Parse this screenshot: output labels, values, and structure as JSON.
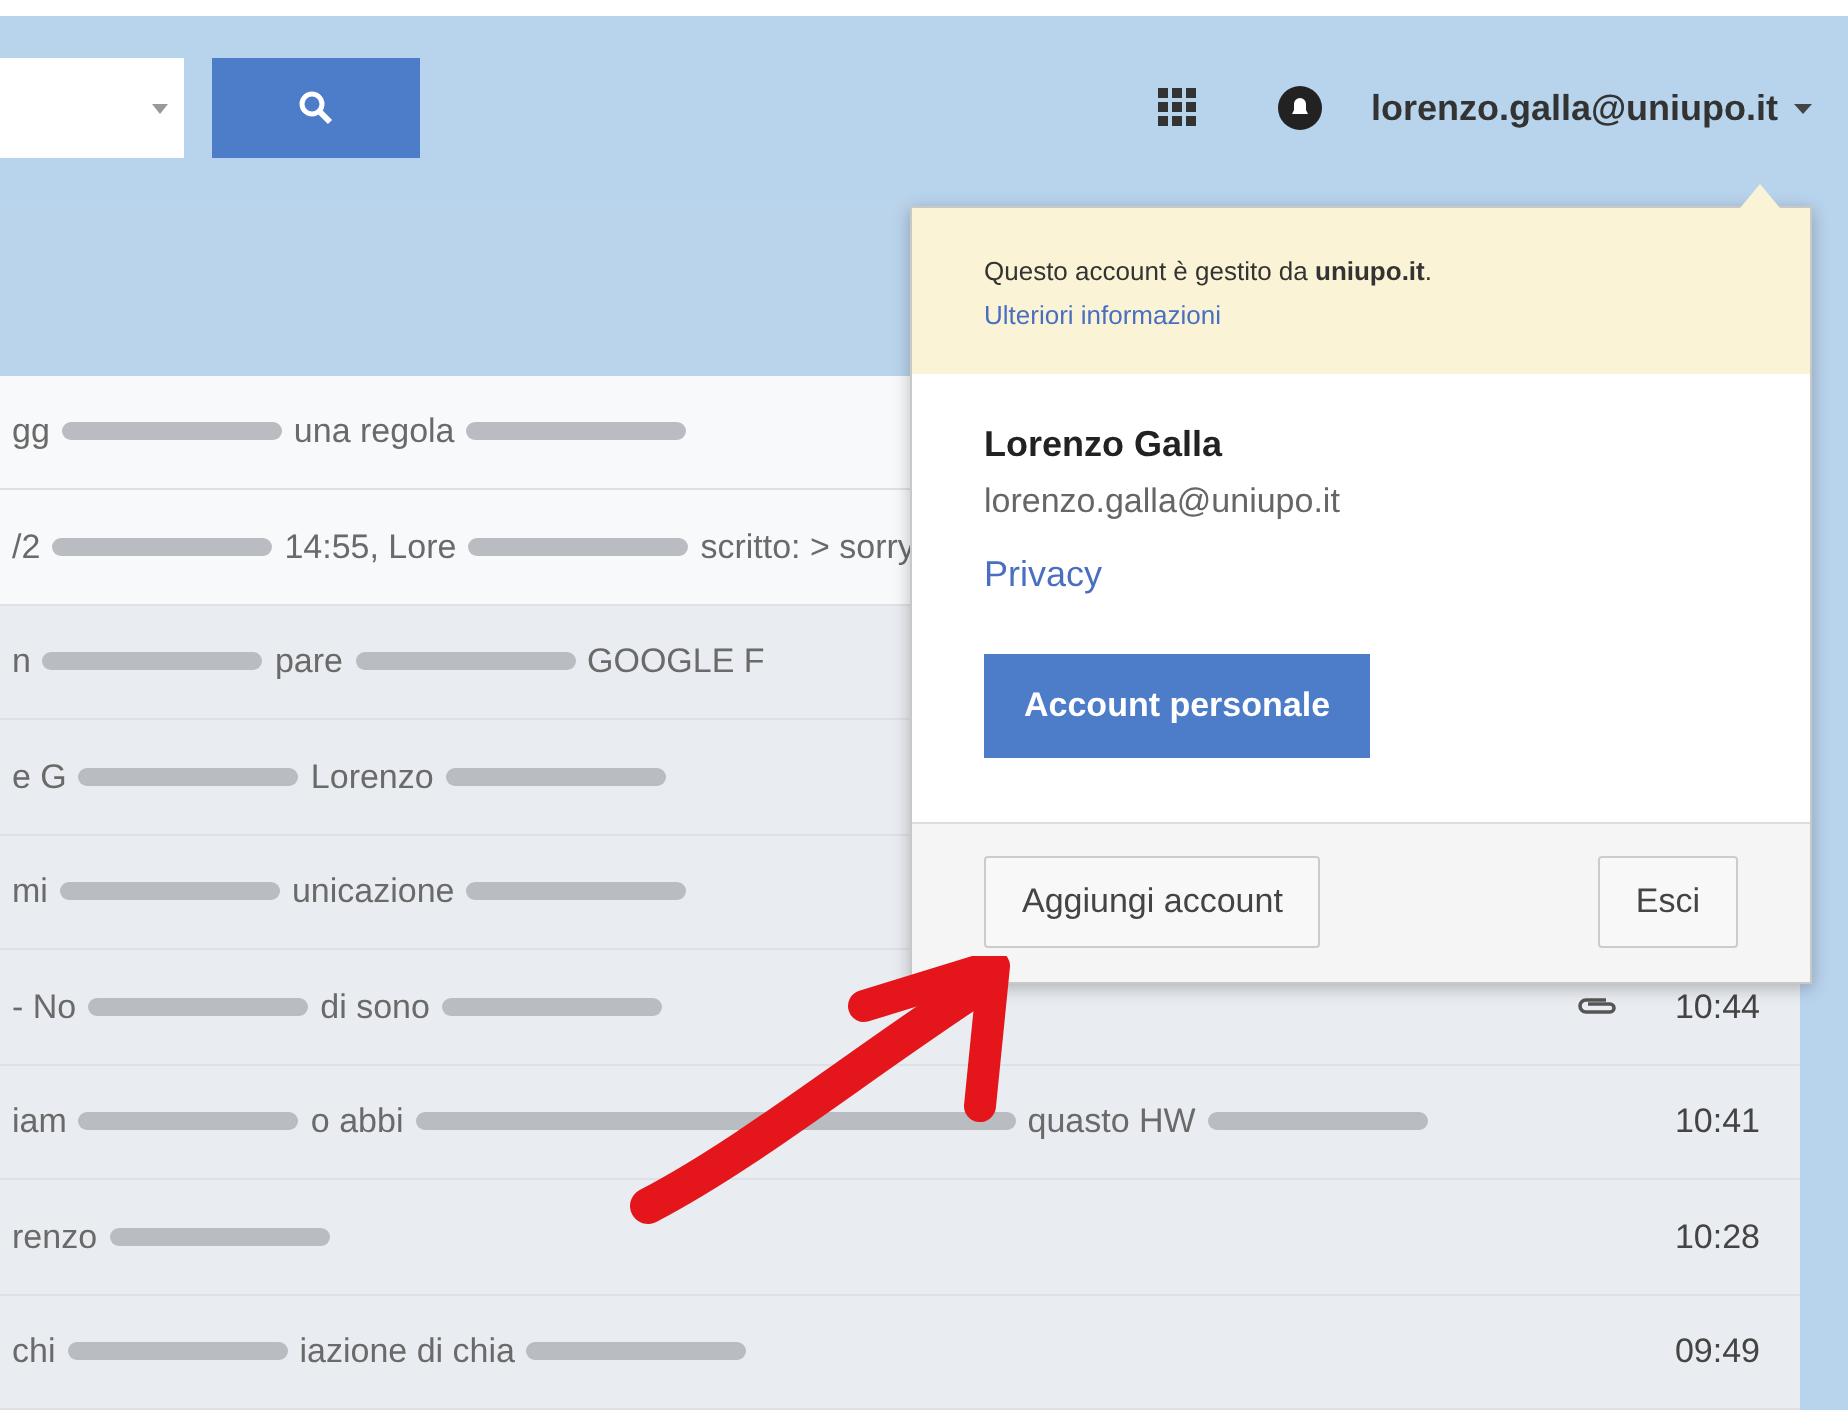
{
  "header": {
    "account_email": "lorenzo.galla@uniupo.it"
  },
  "messages": [
    {
      "unread": true,
      "fragments": [
        {
          "kind": "text",
          "text": "gg"
        },
        {
          "kind": "blur"
        },
        {
          "kind": "text",
          "text": "una regola"
        },
        {
          "kind": "blur"
        }
      ]
    },
    {
      "unread": true,
      "fragments": [
        {
          "kind": "text",
          "text": "/2"
        },
        {
          "kind": "blur"
        },
        {
          "kind": "text",
          "text": "14:55, Lore"
        },
        {
          "kind": "blur"
        },
        {
          "kind": "text",
          "text": "scritto: > sorry"
        }
      ]
    },
    {
      "unread": false,
      "fragments": [
        {
          "kind": "text",
          "text": "n"
        },
        {
          "kind": "blur"
        },
        {
          "kind": "text",
          "text": "pare"
        },
        {
          "kind": "blur"
        },
        {
          "kind": "text",
          "text": "GOOGLE F"
        }
      ]
    },
    {
      "unread": false,
      "fragments": [
        {
          "kind": "text",
          "text": "e G"
        },
        {
          "kind": "blur"
        },
        {
          "kind": "text",
          "text": "Lorenzo"
        },
        {
          "kind": "blur"
        }
      ]
    },
    {
      "unread": false,
      "fragments": [
        {
          "kind": "text",
          "text": "mi"
        },
        {
          "kind": "blur"
        },
        {
          "kind": "text",
          "text": "unicazione"
        },
        {
          "kind": "blur"
        }
      ]
    },
    {
      "unread": false,
      "fragments": [
        {
          "kind": "text",
          "text": "- No"
        },
        {
          "kind": "blur"
        },
        {
          "kind": "text",
          "text": "di sono"
        },
        {
          "kind": "blur"
        }
      ],
      "attachment": true,
      "time": "10:44"
    },
    {
      "unread": false,
      "fragments": [
        {
          "kind": "text",
          "text": "iam"
        },
        {
          "kind": "blur"
        },
        {
          "kind": "text",
          "text": "o abbi"
        },
        {
          "kind": "blur"
        },
        {
          "kind": "text",
          "text": "quasto HW"
        },
        {
          "kind": "blur"
        }
      ],
      "attachment": false,
      "time": "10:41"
    },
    {
      "unread": false,
      "fragments": [
        {
          "kind": "text",
          "text": "renzo"
        },
        {
          "kind": "blur"
        }
      ],
      "attachment": false,
      "time": "10:28"
    },
    {
      "unread": false,
      "fragments": [
        {
          "kind": "text",
          "text": "chi"
        },
        {
          "kind": "blur"
        },
        {
          "kind": "text",
          "text": "iazione di chia"
        },
        {
          "kind": "blur"
        }
      ],
      "attachment": false,
      "time": "09:49"
    }
  ],
  "account_popup": {
    "notice": "Questo account è gestito da **uniupo.it**.",
    "notice_link": "Ulteriori informazioni",
    "name": "Lorenzo Galla",
    "email": "lorenzo.galla@uniupo.it",
    "privacy_link": "Privacy",
    "primary_button": "Account personale",
    "add_account_button": "Aggiungi account",
    "sign_out_button": "Esci"
  }
}
